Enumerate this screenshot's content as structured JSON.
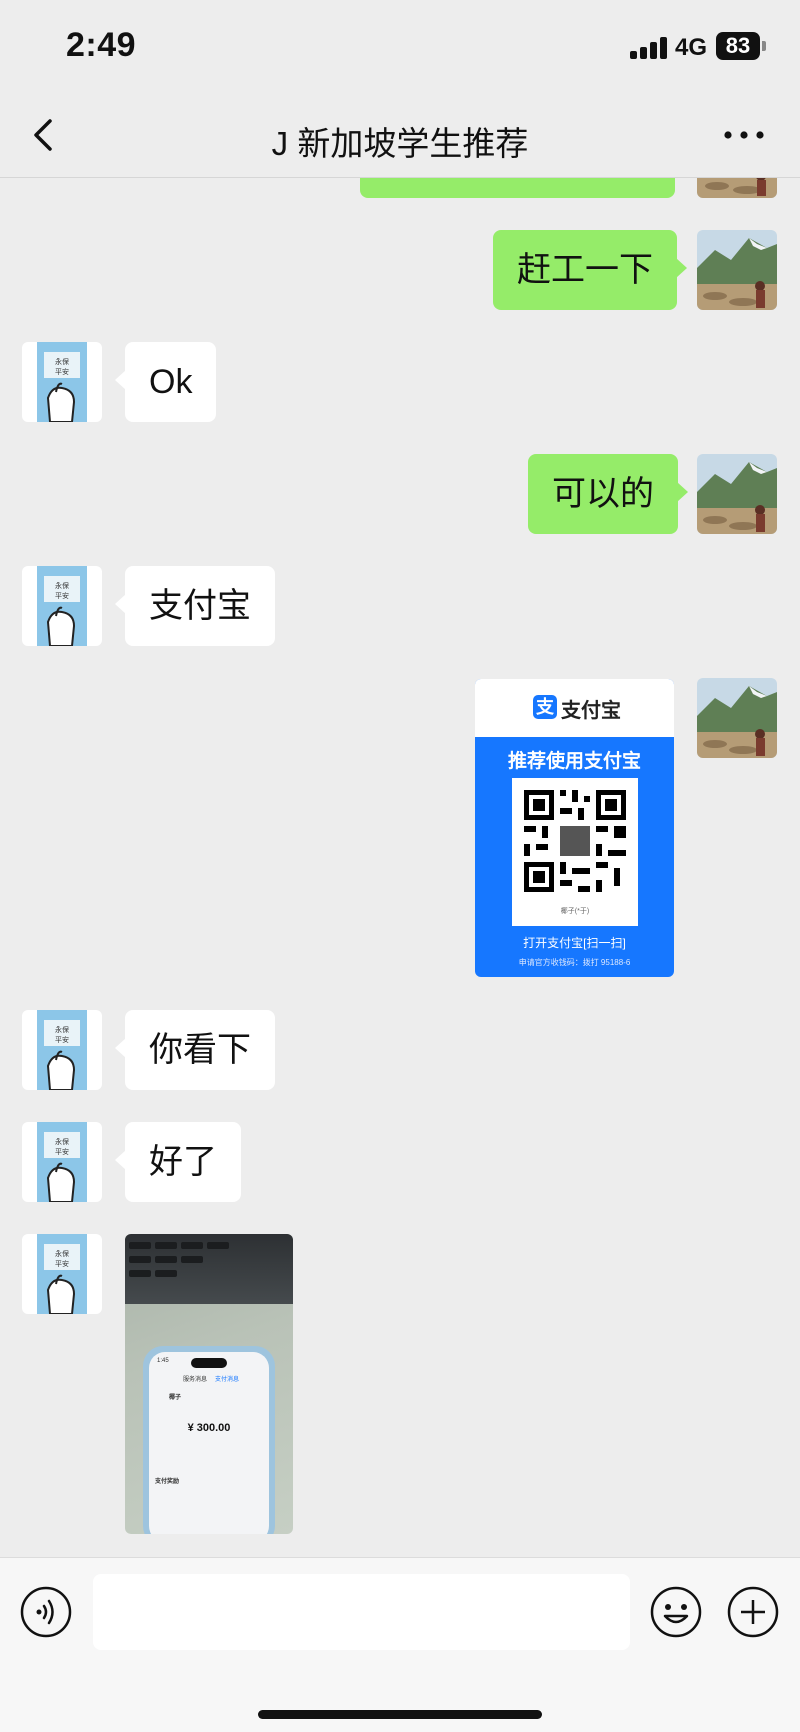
{
  "status_bar": {
    "time": "2:49",
    "network": "4G",
    "battery": "83"
  },
  "nav": {
    "title": "J 新加坡学生推荐"
  },
  "messages": [
    {
      "side": "me",
      "text": ""
    },
    {
      "side": "me",
      "text": "赶工一下"
    },
    {
      "side": "them",
      "text": "Ok"
    },
    {
      "side": "me",
      "text": "可以的"
    },
    {
      "side": "them",
      "text": "支付宝"
    },
    {
      "side": "me",
      "type": "image"
    },
    {
      "side": "them",
      "text": "你看下"
    },
    {
      "side": "them",
      "text": "好了"
    },
    {
      "side": "them",
      "type": "image"
    }
  ],
  "alipay_card": {
    "brand": "支付宝",
    "heading": "推荐使用支付宝",
    "name": "椰子(*于)",
    "open_hint": "打开支付宝[扫一扫]",
    "apply_hint": "申请官方收钱码：拨打 95188-6"
  },
  "photo": {
    "time": "1:45",
    "tab_service": "服务消息",
    "tab_pay": "支付消息",
    "payee": "椰子",
    "amount": "¥ 300.00",
    "section": "支付奖励"
  },
  "input": {
    "placeholder": ""
  },
  "colors": {
    "my_bubble": "#95ec69",
    "their_bubble": "#ffffff",
    "alipay_blue": "#1677ff",
    "background": "#ededed"
  }
}
